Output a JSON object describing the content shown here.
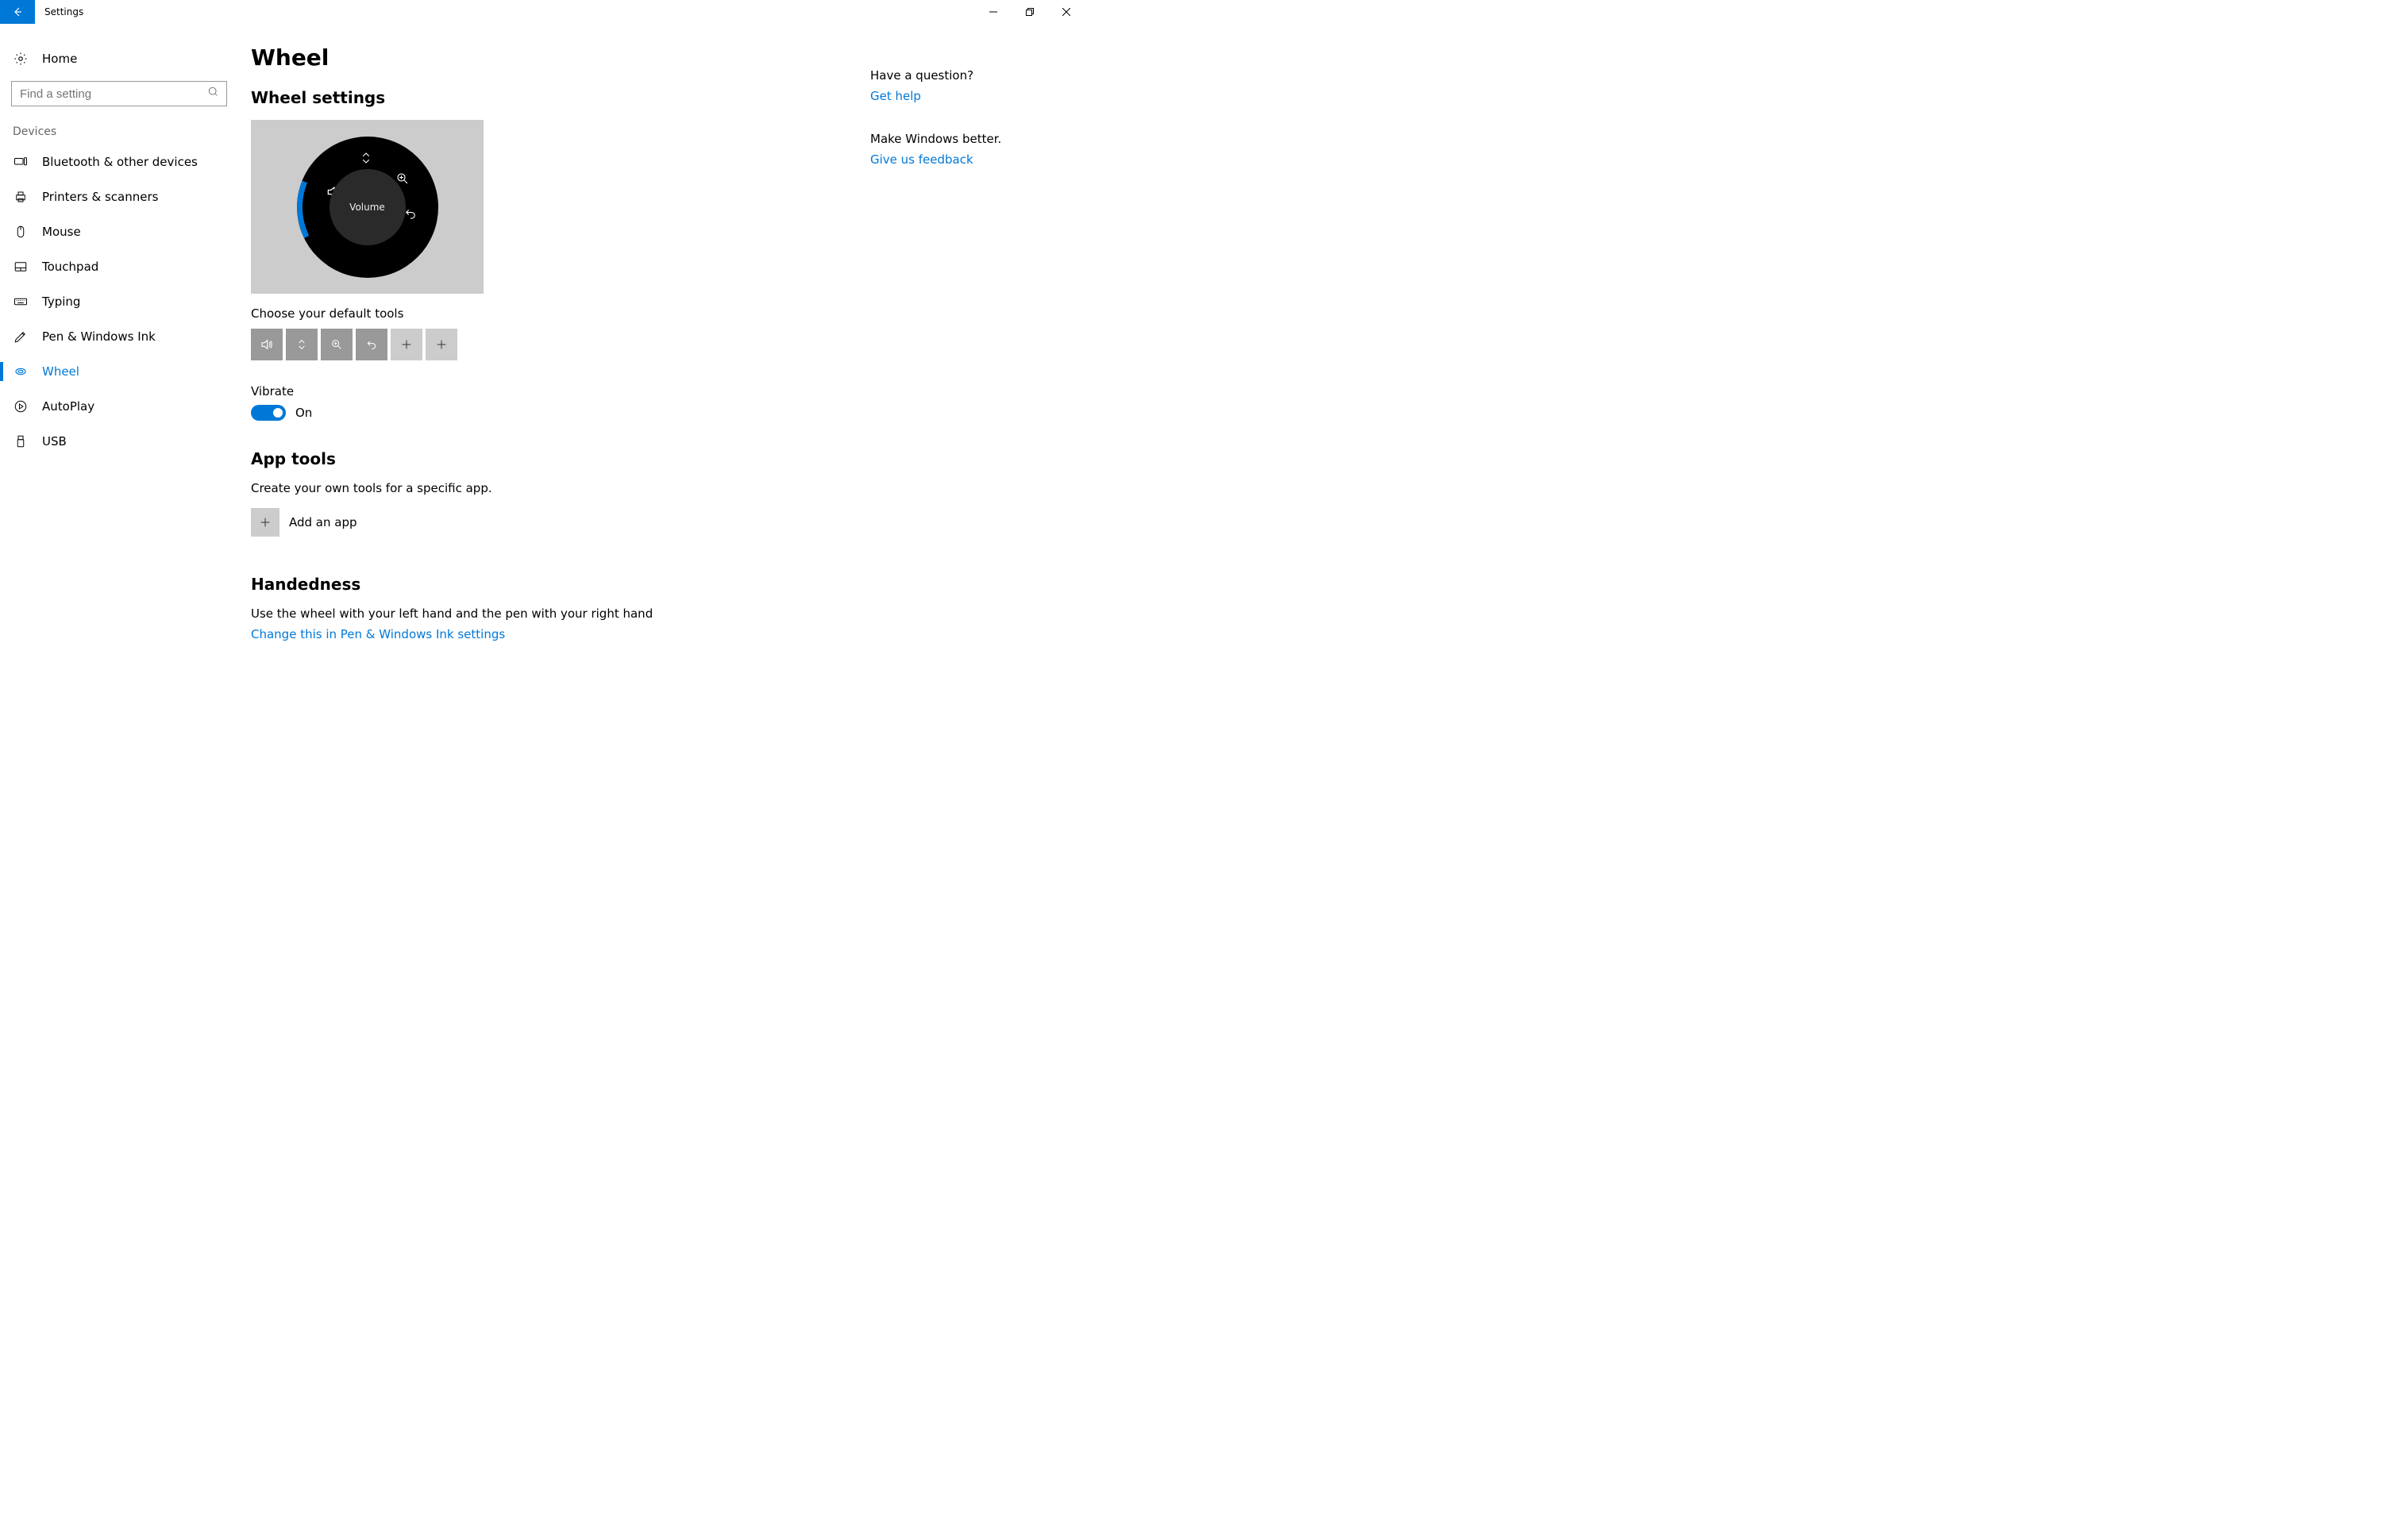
{
  "window": {
    "title": "Settings"
  },
  "sidebar": {
    "home": "Home",
    "search_placeholder": "Find a setting",
    "category": "Devices",
    "items": [
      {
        "label": "Bluetooth & other devices"
      },
      {
        "label": "Printers & scanners"
      },
      {
        "label": "Mouse"
      },
      {
        "label": "Touchpad"
      },
      {
        "label": "Typing"
      },
      {
        "label": "Pen & Windows Ink"
      },
      {
        "label": "Wheel"
      },
      {
        "label": "AutoPlay"
      },
      {
        "label": "USB"
      }
    ],
    "active_index": 6
  },
  "page": {
    "title": "Wheel",
    "wheel_settings": {
      "heading": "Wheel settings",
      "radial_center_label": "Volume",
      "choose_tools_label": "Choose your default tools",
      "vibrate_label": "Vibrate",
      "vibrate_state": "On"
    },
    "app_tools": {
      "heading": "App tools",
      "description": "Create your own tools for a specific app.",
      "add_label": "Add an app"
    },
    "handedness": {
      "heading": "Handedness",
      "description": "Use the wheel with your left hand and the pen with your right hand",
      "link": "Change this in Pen & Windows Ink settings"
    }
  },
  "aside": {
    "question_heading": "Have a question?",
    "help_link": "Get help",
    "feedback_heading": "Make Windows better.",
    "feedback_link": "Give us feedback"
  }
}
